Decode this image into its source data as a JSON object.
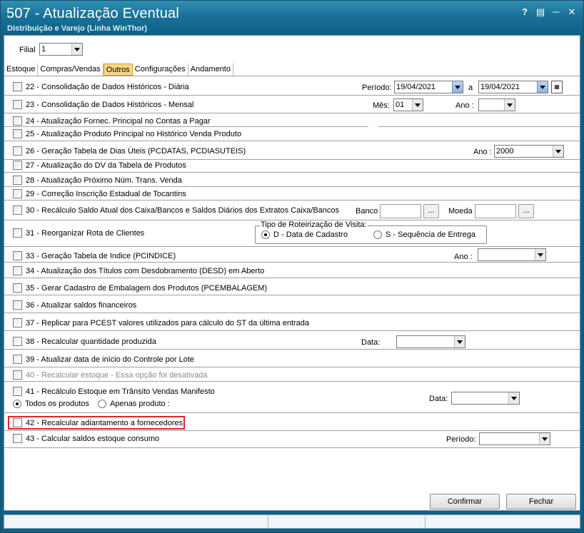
{
  "window": {
    "title": "507 - Atualização Eventual",
    "subtitle": "Distribuição e Varejo (Linha WinThor)",
    "help_label": "?",
    "close_label": "✕"
  },
  "filial": {
    "label": "Filial",
    "value": "1"
  },
  "tabs": [
    {
      "label": "Estoque"
    },
    {
      "label": "Compras/Vendas"
    },
    {
      "label": "Outros",
      "active": true
    },
    {
      "label": "Configurações"
    },
    {
      "label": "Andamento"
    }
  ],
  "options": {
    "o22": "22 - Consolidação de Dados Históricos - Diária",
    "o23": "23 - Consolidação de Dados Históricos - Mensal",
    "o24": "24 - Atualização Fornec. Principal no Contas a Pagar",
    "o25": "25 - Atualização Produto Principal no Histórico Venda Produto",
    "o26": "26 - Geração Tabela de Dias Úteis (PCDATAS, PCDIASUTEIS)",
    "o27": "27 - Atualização do DV da Tabela de Produtos",
    "o28": "28 - Atualização Próximo Núm. Trans. Venda",
    "o29": "29 - Correção Inscrição Estadual de Tocantins",
    "o30": "30 - Recálculo Saldo Atual dos Caixa/Bancos e Saldos Diários dos Extratos Caixa/Bancos",
    "o31": "31 - Reorganizar Rota de Clientes",
    "o33": "33 - Geração Tabela de Indice (PCINDICE)",
    "o34": "34 - Atualização dos Títulos com Desdobramento (DESD) em Aberto",
    "o35": "35 - Gerar Cadastro de Embalagem dos Produtos (PCEMBALAGEM)",
    "o36": "36 - Atualizar saldos financeiros",
    "o37": "37 - Replicar para PCEST valores utilizados para cálculo do ST da última entrada",
    "o38": "38 - Recalcular quantidade produzida",
    "o39": "39 - Atualizar data de início do Controle por Lote",
    "o40": "40 - Recalcular estoque - Essa opção foi desativada",
    "o41": "41 - Recálculo Estoque em Trânsito Vendas Manifesto",
    "o42": "42 - Recalcular adiantamento a fornecedores",
    "o43": "43 - Calcular saldos estoque consumo"
  },
  "fields": {
    "periodo_label": "Período:",
    "periodo_de": "19/04/2021",
    "a_label": "a",
    "periodo_ate": "19/04/2021",
    "mes_label": "Mês:",
    "mes_value": "01",
    "ano_label": "Ano :",
    "ano23_value": "",
    "ano26_label": "Ano :",
    "ano26_value": "2000",
    "banco_label": "Banco",
    "moeda_label": "Moeda",
    "dots_label": "...",
    "rot_group_title": "Tipo de Roteirização de Visita:",
    "rot_opt1": "D - Data de Cadastro",
    "rot_opt2": "S - Sequência de Entrega",
    "ano33_label": "Ano :",
    "data38_label": "Data:",
    "todos_produtos": "Todos os produtos",
    "apenas_produto": "Apenas produto :",
    "data41_label": "Data:",
    "periodo43_label": "Período:"
  },
  "buttons": {
    "confirmar": "Confirmar",
    "fechar": "Fechar"
  }
}
